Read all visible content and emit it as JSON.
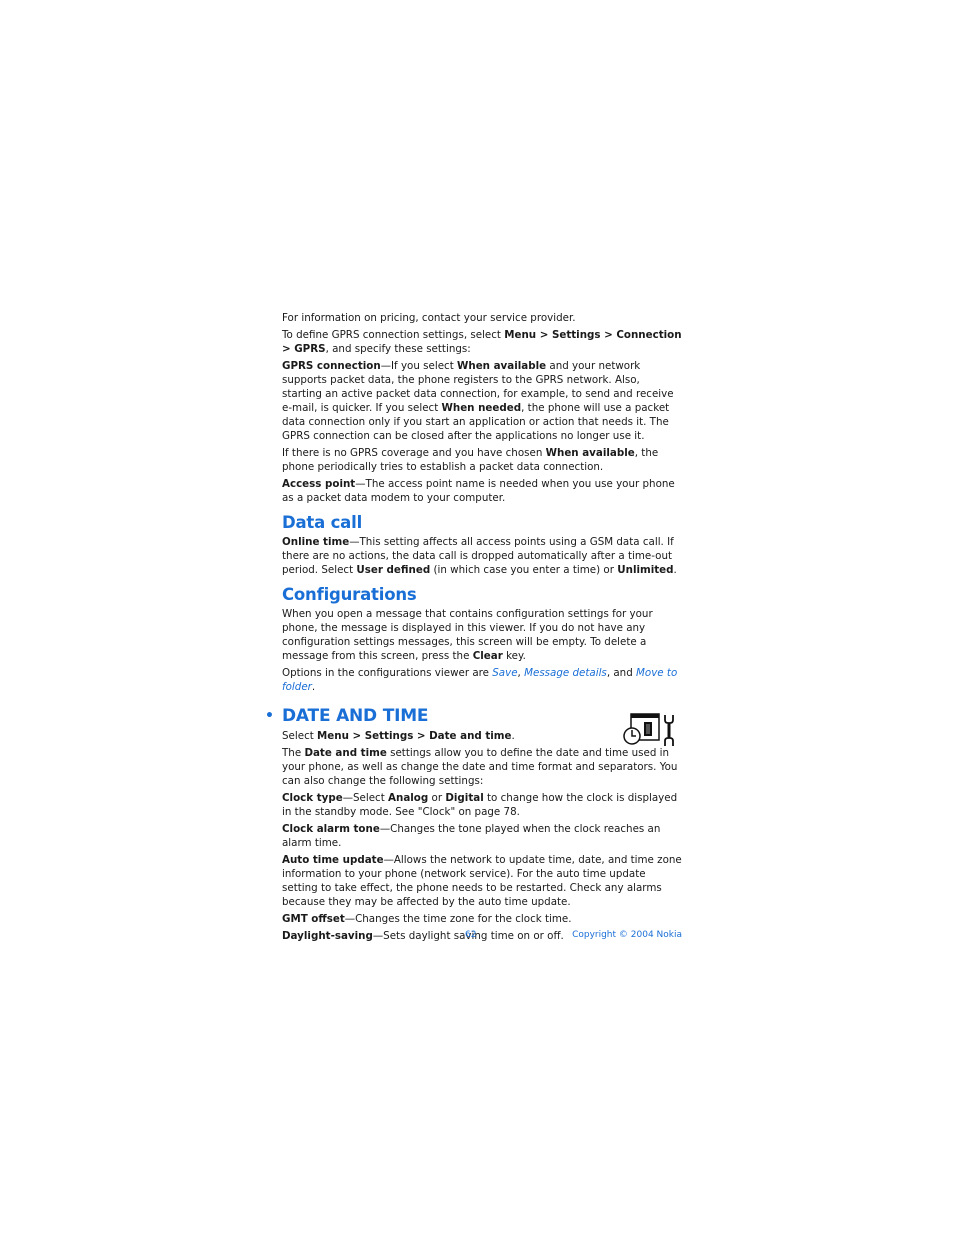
{
  "intro": {
    "pricing": "For information on pricing, contact your service provider.",
    "gprs_define_prefix": "To define GPRS connection settings, select ",
    "gprs_path": "Menu > Settings > Connection > GPRS",
    "gprs_define_suffix": ", and specify these settings:"
  },
  "gprs_connection": {
    "term": "GPRS connection",
    "t1": "—If you select ",
    "b1": "When available",
    "t2": " and your network supports packet data, the phone registers to the GPRS network. Also, starting an active packet data connection, for example, to send and receive e-mail, is quicker. If you select ",
    "b2": "When needed",
    "t3": ", the phone will use a packet data connection only if you start an application or action that needs it. The GPRS connection can be closed after the applications no longer use it."
  },
  "no_coverage": {
    "t1": "If there is no GPRS coverage and you have chosen ",
    "b1": "When available",
    "t2": ", the phone periodically tries to establish a packet data connection."
  },
  "access_point": {
    "term": "Access point",
    "text": "—The access point name is needed when you use your phone as a packet data modem to your computer."
  },
  "data_call": {
    "heading": "Data call",
    "term": "Online time",
    "t1": "—This setting affects all access points using a GSM data call. If there are no actions, the data call is dropped automatically after a time-out period. Select ",
    "b1": "User defined",
    "t2": " (in which case you enter a time) or ",
    "b2": "Unlimited",
    "t3": "."
  },
  "configurations": {
    "heading": "Configurations",
    "p1_text": "When you open a message that contains configuration settings for your phone, the message is displayed in this viewer. If you do not have any configuration settings messages, this screen will be empty. To delete a message from this screen, press the ",
    "p1_bold": "Clear",
    "p1_end": " key.",
    "p2_prefix": "Options in the configurations viewer are ",
    "opt1": "Save",
    "sep1": ", ",
    "opt2": "Message details",
    "sep2": ", and ",
    "opt3": "Move to folder",
    "p2_end": "."
  },
  "date_time": {
    "bullet": "•",
    "heading": "DATE AND TIME",
    "select_prefix": "Select ",
    "select_path": "Menu > Settings > Date and time",
    "select_end": ".",
    "desc_t1": "The ",
    "desc_b1": "Date and time",
    "desc_t2": " settings allow you to define the date and time used in your phone, as well as change the date and time format and separators. You can also change the following settings:",
    "clock_type_term": "Clock type",
    "clock_type_t1": "—Select ",
    "clock_type_b1": "Analog",
    "clock_type_t2": " or ",
    "clock_type_b2": "Digital",
    "clock_type_t3": " to change how the clock is displayed in the standby mode. See \"Clock\" on page 78.",
    "alarm_term": "Clock alarm tone",
    "alarm_text": "—Changes the tone played when the clock reaches an alarm time.",
    "auto_term": "Auto time update",
    "auto_text": "—Allows the network to update time, date, and time zone information to your phone (network service). For the auto time update setting to take effect, the phone needs to be restarted. Check any alarms because they may be affected by the auto time update.",
    "gmt_term": "GMT offset",
    "gmt_text": "—Changes the time zone for the clock time.",
    "dst_term": "Daylight-saving",
    "dst_text": "—Sets daylight saving time on or off.",
    "icon": "clock-settings-icon"
  },
  "footer": {
    "page_number": "62",
    "copyright": "Copyright © 2004 Nokia"
  }
}
